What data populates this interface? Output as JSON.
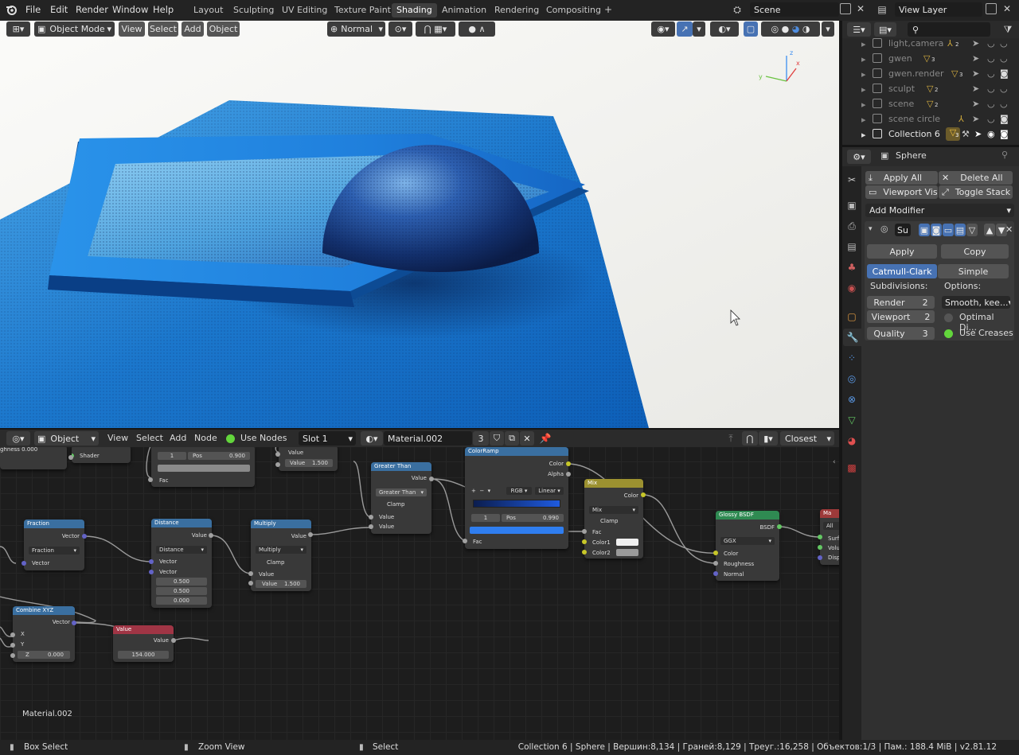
{
  "topbar": {
    "menus": [
      "File",
      "Edit",
      "Render",
      "Window",
      "Help"
    ],
    "workspaces": [
      "Layout",
      "Sculpting",
      "UV Editing",
      "Texture Paint",
      "Shading",
      "Animation",
      "Rendering",
      "Compositing"
    ],
    "active_workspace": "Shading",
    "scene": "Scene",
    "view_layer": "View Layer"
  },
  "viewport": {
    "mode": "Object Mode",
    "menus": [
      "View",
      "Select",
      "Add",
      "Object"
    ],
    "orientation": "Normal",
    "gizmo_axes": [
      "x",
      "y",
      "z"
    ]
  },
  "outliner": {
    "items": [
      {
        "name": "light,camera",
        "count": "2"
      },
      {
        "name": "gwen",
        "count": "3"
      },
      {
        "name": "gwen.render",
        "count": "3"
      },
      {
        "name": "sculpt",
        "count": "2"
      },
      {
        "name": "scene",
        "count": "2"
      },
      {
        "name": "scene circle",
        "count": ""
      },
      {
        "name": "Collection 6",
        "count": "3"
      }
    ]
  },
  "properties": {
    "object_name": "Sphere",
    "apply_all": "Apply All",
    "delete_all": "Delete All",
    "viewport_vis": "Viewport Vis",
    "toggle_stack": "Toggle Stack",
    "add_modifier": "Add Modifier",
    "mod_name": "Su",
    "apply": "Apply",
    "copy": "Copy",
    "catmull": "Catmull-Clark",
    "simple": "Simple",
    "subdivisions": "Subdivisions:",
    "options": "Options:",
    "render_label": "Render",
    "render_val": "2",
    "viewport_label": "Viewport",
    "viewport_val": "2",
    "quality_label": "Quality",
    "quality_val": "3",
    "smooth": "Smooth, kee...",
    "optimal": "Optimal Di...",
    "use_creases": "Use Creases"
  },
  "node_editor": {
    "object": "Object",
    "menus": [
      "View",
      "Select",
      "Add",
      "Node"
    ],
    "use_nodes": "Use Nodes",
    "slot": "Slot 1",
    "material": "Material.002",
    "users": "3",
    "interp": "Closest",
    "material_label": "Material.002"
  },
  "nodes": {
    "top_left": {
      "label": "ghness",
      "value": "0.000",
      "shader": "Shader"
    },
    "top_mid": {
      "f1": "1",
      "pos": "Pos",
      "posv": "0.900",
      "fac": "Fac"
    },
    "top_val": {
      "value": "Value",
      "value2": "Value",
      "v": "1.500"
    },
    "greater": {
      "title": "Greater Than",
      "out": "Value",
      "op": "Greater Than",
      "clamp": "Clamp",
      "in1": "Value",
      "in2": "Value"
    },
    "ramp": {
      "title": "ColorRamp",
      "color": "Color",
      "alpha": "Alpha",
      "mode": "RGB",
      "interp": "Linear",
      "idx": "1",
      "pos": "Pos",
      "posv": "0.990",
      "fac": "Fac",
      "plus": "+",
      "minus": "−"
    },
    "mix": {
      "title": "Mix",
      "color": "Color",
      "op": "Mix",
      "clamp": "Clamp",
      "fac": "Fac",
      "c1": "Color1",
      "c2": "Color2"
    },
    "glossy": {
      "title": "Glossy BSDF",
      "bsdf": "BSDF",
      "dist": "GGX",
      "color": "Color",
      "rough": "Roughness",
      "normal": "Normal"
    },
    "out": {
      "title": "Ma",
      "all": "All",
      "surf": "Surf",
      "vol": "Volu",
      "disp": "Disp"
    },
    "fraction": {
      "title": "Fraction",
      "out": "Vector",
      "op": "Fraction",
      "in": "Vector"
    },
    "distance": {
      "title": "Distance",
      "out": "Value",
      "op": "Distance",
      "v1": "Vector",
      "v2": "Vector",
      "a": "0.500",
      "b": "0.500",
      "c": "0.000"
    },
    "multiply": {
      "title": "Multiply",
      "out": "Value",
      "op": "Multiply",
      "clamp": "Clamp",
      "in": "Value",
      "v": "Value",
      "vv": "1.500"
    },
    "combine": {
      "title": "Combine XYZ",
      "out": "Vector",
      "x": "X",
      "y": "Y",
      "z": "Z",
      "zv": "0.000"
    },
    "value": {
      "title": "Value",
      "out": "Value",
      "v": "154.000"
    }
  },
  "status": {
    "box_select": "Box Select",
    "zoom_view": "Zoom View",
    "select": "Select",
    "info": "Collection 6 | Sphere | Вершин:8,134 | Граней:8,129 | Треуг.:16,258 | Объектов:1/3 | Пам.: 188.4 MiB | v2.81.12"
  }
}
